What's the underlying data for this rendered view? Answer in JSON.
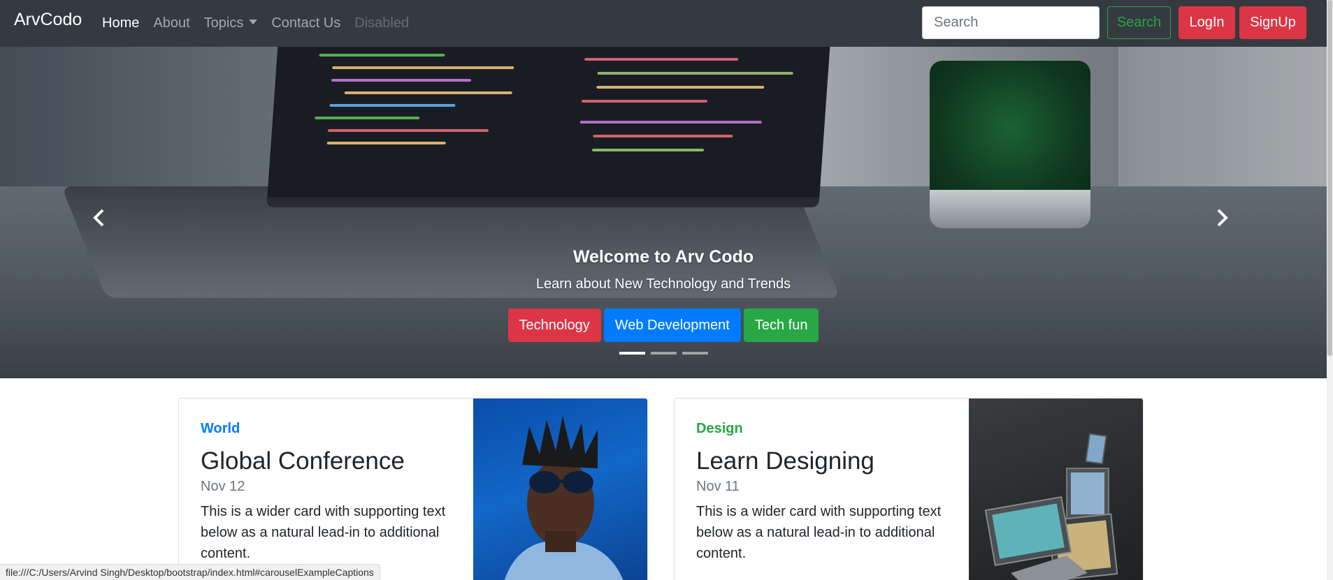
{
  "navbar": {
    "brand": "ArvCodo",
    "links": [
      {
        "label": "Home",
        "state": "active"
      },
      {
        "label": "About",
        "state": "normal"
      },
      {
        "label": "Topics",
        "state": "dropdown"
      },
      {
        "label": "Contact Us",
        "state": "normal"
      },
      {
        "label": "Disabled",
        "state": "disabled"
      }
    ],
    "search_placeholder": "Search",
    "search_button": "Search",
    "login_button": "LogIn",
    "signup_button": "SignUp"
  },
  "carousel": {
    "title": "Welcome to Arv Codo",
    "subtitle": "Learn about New Technology and Trends",
    "buttons": [
      "Technology",
      "Web Development",
      "Tech fun"
    ],
    "slide_count": 3,
    "active_slide": 1,
    "prev_icon": "chevron-left-icon",
    "next_icon": "chevron-right-icon"
  },
  "cards": [
    {
      "category": "World",
      "title": "Global Conference",
      "date": "Nov 12",
      "text": "This is a wider card with supporting text below as a natural lead-in to additional content.",
      "image": "person-with-sunglasses-photo"
    },
    {
      "category": "Design",
      "title": "Learn Designing",
      "date": "Nov 11",
      "text": "This is a wider card with supporting text below as a natural lead-in to additional content.",
      "image": "laptops-photo"
    }
  ],
  "status_bar": {
    "url": "file:///C:/Users/Arvind Singh/Desktop/bootstrap/index.html#carouselExampleCaptions"
  },
  "colors": {
    "navbar_bg": "#343a40",
    "danger": "#dc3545",
    "primary": "#007bff",
    "success": "#28a745"
  }
}
